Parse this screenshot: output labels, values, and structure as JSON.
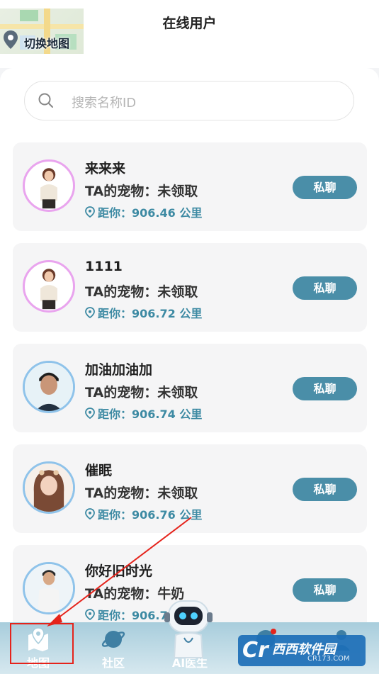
{
  "header": {
    "map_switch_label": "切换地图",
    "title": "在线用户"
  },
  "search": {
    "placeholder": "搜索名称ID"
  },
  "users": [
    {
      "name": "来来来",
      "pet": "TA的宠物：未领取",
      "distance": "距你：906.46 公里",
      "chat_label": "私聊",
      "avatar_style": "woman-pink"
    },
    {
      "name": "1111",
      "pet": "TA的宠物：未领取",
      "distance": "距你：906.72 公里",
      "chat_label": "私聊",
      "avatar_style": "woman-pink"
    },
    {
      "name": "加油加油加",
      "pet": "TA的宠物：未领取",
      "distance": "距你：906.74 公里",
      "chat_label": "私聊",
      "avatar_style": "man-blue"
    },
    {
      "name": "催眠",
      "pet": "TA的宠物：未领取",
      "distance": "距你：906.76 公里",
      "chat_label": "私聊",
      "avatar_style": "girl-blue"
    },
    {
      "name": "你好旧时光",
      "pet": "TA的宠物：牛奶",
      "distance": "距你：906.7",
      "chat_label": "私聊",
      "avatar_style": "man-white-shirt"
    }
  ],
  "tabbar": {
    "tabs": [
      {
        "label": "地图",
        "icon": "map-icon"
      },
      {
        "label": "社区",
        "icon": "planet-icon"
      },
      {
        "label": "AI医生",
        "icon": "robot-icon"
      },
      {
        "label": "",
        "icon": "message-icon"
      },
      {
        "label": "",
        "icon": "profile-icon"
      }
    ]
  },
  "watermark": {
    "brand": "西西软件园",
    "domain": "CR173.COM"
  },
  "colors": {
    "accent": "#4a8ea8",
    "distance": "#3d8aa3",
    "highlight": "#e5231b",
    "tabbar": "#a8cddc"
  }
}
